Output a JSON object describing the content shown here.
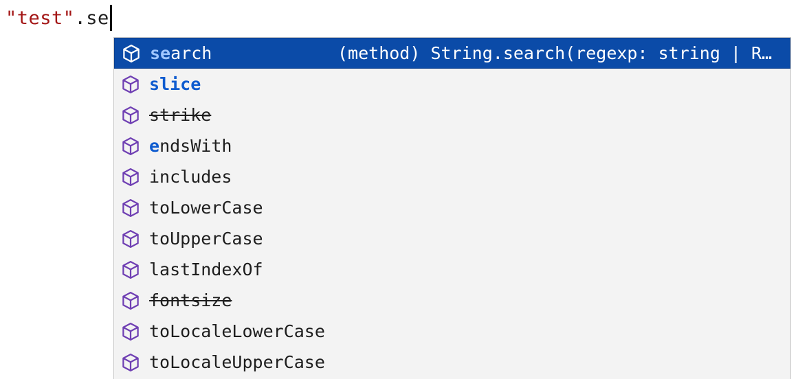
{
  "editor": {
    "string_part": "\"test\"",
    "typed_part": ".se"
  },
  "suggestions": [
    {
      "prefix": "se",
      "rest": "arch",
      "deprecated": false,
      "detail": "(method) String.search(regexp: string | R…",
      "selected": true
    },
    {
      "prefix": "s",
      "rest": "lic",
      "tail": "e",
      "deprecated": false,
      "selected": false
    },
    {
      "label": "strike",
      "deprecated": true,
      "selected": false
    },
    {
      "prefix": "e",
      "rest": "ndsWith",
      "deprecated": false,
      "selected": false
    },
    {
      "label": "includes",
      "deprecated": false,
      "selected": false
    },
    {
      "label": "toLowerCase",
      "deprecated": false,
      "selected": false
    },
    {
      "label": "toUpperCase",
      "deprecated": false,
      "selected": false
    },
    {
      "label": "lastIndexOf",
      "deprecated": false,
      "selected": false
    },
    {
      "label": "fontsize",
      "deprecated": true,
      "selected": false
    },
    {
      "label": "toLocaleLowerCase",
      "deprecated": false,
      "selected": false
    },
    {
      "label": "toLocaleUpperCase",
      "deprecated": false,
      "selected": false
    }
  ],
  "colors": {
    "selection": "#0b4ba8",
    "match": "#0e5bcf",
    "string": "#a31515",
    "icon_method": "#6f3fb3"
  },
  "icons": {
    "method": "cube-method-icon"
  }
}
